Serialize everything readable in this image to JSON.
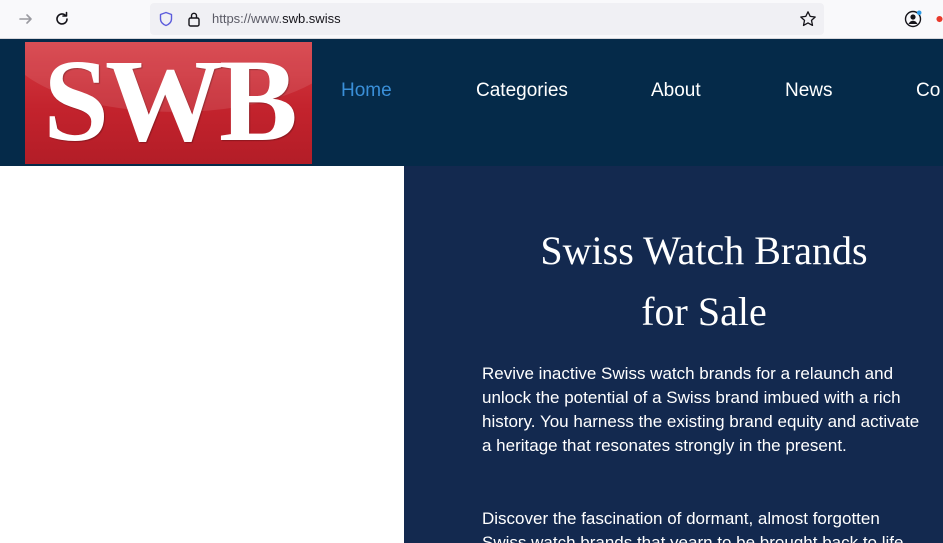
{
  "browser": {
    "url_prefix": "https://www.",
    "url_host": "swb.swiss"
  },
  "site": {
    "logo_text": "SWB",
    "nav": [
      "Home",
      "Categories",
      "About",
      "News",
      "Co"
    ],
    "active_nav": "Home"
  },
  "hero": {
    "title_line1": "Swiss Watch Brands",
    "title_line2": "for Sale",
    "paragraph1": "Revive inactive Swiss watch brands for a relaunch and unlock the potential of a Swiss brand imbued with a rich history. You harness the existing brand equity and activate a heritage that resonates strongly in the present.",
    "paragraph2": "Discover the fascination of dormant, almost forgotten Swiss watch brands that yearn to be brought back to life."
  },
  "colors": {
    "header_bg": "#052a49",
    "hero_bg": "#13294f",
    "logo_red": "#c3232d",
    "nav_active": "#3a8fd8"
  }
}
